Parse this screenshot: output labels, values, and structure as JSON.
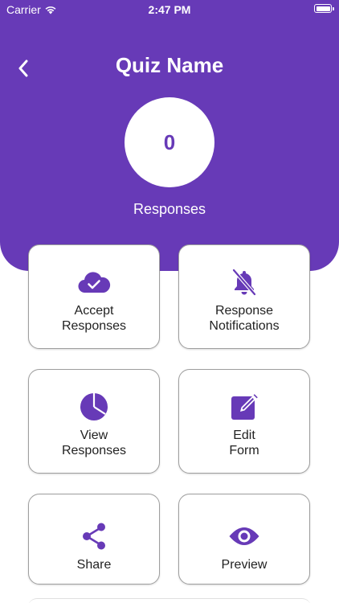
{
  "status_bar": {
    "carrier": "Carrier",
    "time": "2:47 PM",
    "battery_level": 1.0
  },
  "header": {
    "back_icon": "chevron-left-icon",
    "title": "Quiz Name",
    "response_count": "0",
    "response_label": "Responses"
  },
  "colors": {
    "accent": "#673ab7",
    "card_border": "#9e9e9e",
    "text": "#222222"
  },
  "actions": [
    {
      "label": "Accept\nResponses",
      "icon": "cloud-check-icon"
    },
    {
      "label": "Response\nNotifications",
      "icon": "bell-off-icon"
    },
    {
      "label": "View\nResponses",
      "icon": "pie-chart-icon"
    },
    {
      "label": "Edit\nForm",
      "icon": "edit-icon"
    },
    {
      "label": "Share",
      "icon": "share-icon"
    },
    {
      "label": "Preview",
      "icon": "eye-icon"
    }
  ]
}
